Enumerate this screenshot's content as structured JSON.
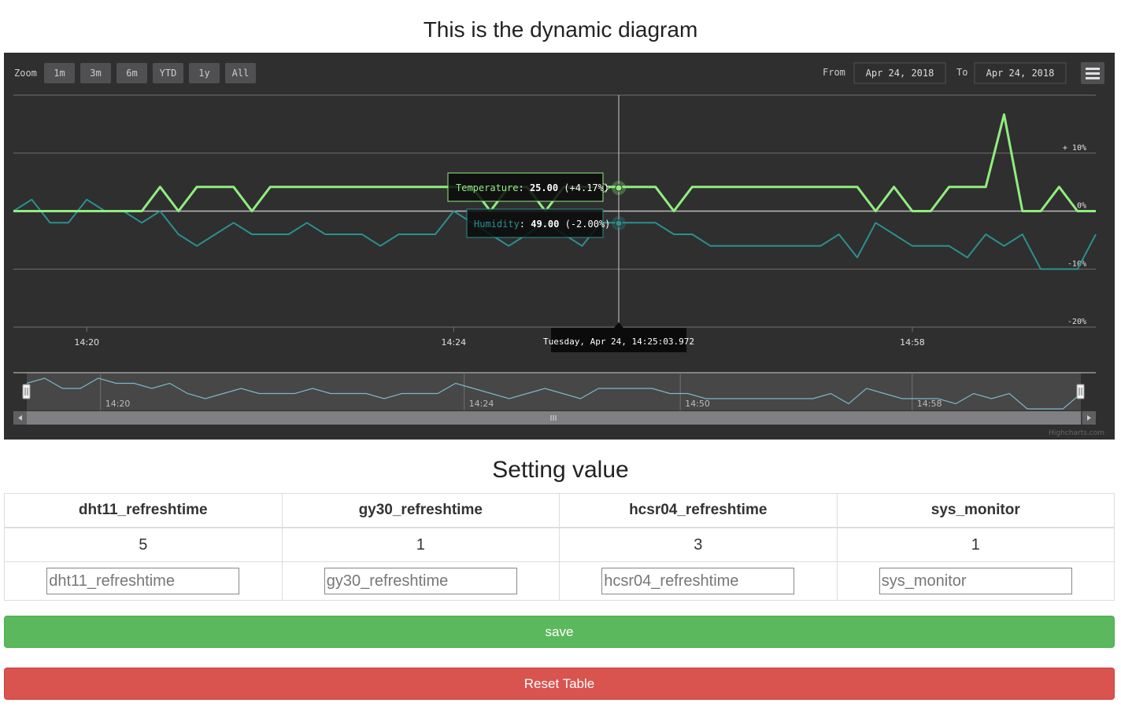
{
  "page": {
    "title": "This is the dynamic diagram"
  },
  "chart_data": {
    "type": "line",
    "range_selector": {
      "zoom_label": "Zoom",
      "buttons": [
        "1m",
        "3m",
        "6m",
        "YTD",
        "1y",
        "All"
      ],
      "from_label": "From",
      "from_value": "Apr 24, 2018",
      "to_label": "To",
      "to_value": "Apr 24, 2018"
    },
    "y_ticks": [
      {
        "value": 20,
        "label": ""
      },
      {
        "value": 10,
        "label": "+ 10%"
      },
      {
        "value": 0,
        "label": "0%"
      },
      {
        "value": -10,
        "label": "-10%"
      },
      {
        "value": -20,
        "label": "-20%"
      }
    ],
    "ylim": [
      -20,
      20
    ],
    "x_ticks": [
      {
        "index": 4,
        "label": "14:20"
      },
      {
        "index": 24,
        "label": "14:24"
      },
      {
        "index": 49,
        "label": "14:58"
      }
    ],
    "x_count": 60,
    "series": [
      {
        "name": "Temperature",
        "color": "#90ee7e",
        "values": [
          0,
          0,
          0,
          0,
          0,
          0,
          0,
          0,
          4.17,
          0,
          4.17,
          4.17,
          4.17,
          0,
          4.17,
          4.17,
          4.17,
          4.17,
          4.17,
          4.17,
          4.17,
          4.17,
          4.17,
          4.17,
          4.17,
          4.17,
          0,
          4.17,
          4.17,
          0,
          4.17,
          4.17,
          4.17,
          4.17,
          4.17,
          4.17,
          0,
          4.17,
          4.17,
          4.17,
          4.17,
          4.17,
          4.17,
          4.17,
          4.17,
          4.17,
          4.17,
          0,
          4.17,
          0,
          0,
          4.17,
          4.17,
          4.17,
          16.67,
          0,
          0,
          4.17,
          0,
          0
        ]
      },
      {
        "name": "Humidity",
        "color": "#2b908f",
        "values": [
          0,
          2,
          -2,
          -2,
          2,
          0,
          0,
          -2,
          0,
          -4,
          -6,
          -4,
          -2,
          -4,
          -4,
          -4,
          -2,
          -4,
          -4,
          -4,
          -6,
          -4,
          -4,
          -4,
          0,
          -2,
          -4,
          -6,
          -4,
          -2,
          -4,
          -6,
          -2,
          -2,
          -2,
          -2,
          -4,
          -4,
          -6,
          -6,
          -6,
          -6,
          -6,
          -6,
          -6,
          -4,
          -8,
          -2,
          -4,
          -6,
          -6,
          -6,
          -8,
          -4,
          -6,
          -4,
          -10,
          -10,
          -10,
          -4
        ]
      }
    ],
    "tooltip": {
      "temperature_label": "Temperature",
      "temperature_value": "25.00",
      "temperature_change": "(+4.17%)",
      "humidity_label": "Humidity",
      "humidity_value": "49.00",
      "humidity_change": "(-2.00%)",
      "date": "Tuesday, Apr 24, 14:25:03.972"
    },
    "navigator": {
      "ticks": [
        "14:20",
        "14:24",
        "14:50",
        "14:58"
      ]
    },
    "credits": "Highcharts.com",
    "colors": {
      "background": "#2f2f2f",
      "grid": "#707073"
    }
  },
  "settings": {
    "title": "Setting value",
    "columns": [
      "dht11_refreshtime",
      "gy30_refreshtime",
      "hcsr04_refreshtime",
      "sys_monitor"
    ],
    "values": [
      "5",
      "1",
      "3",
      "1"
    ],
    "placeholders": [
      "dht11_refreshtime",
      "gy30_refreshtime",
      "hcsr04_refreshtime",
      "sys_monitor"
    ]
  },
  "buttons": {
    "save": "save",
    "reset": "Reset Table"
  }
}
